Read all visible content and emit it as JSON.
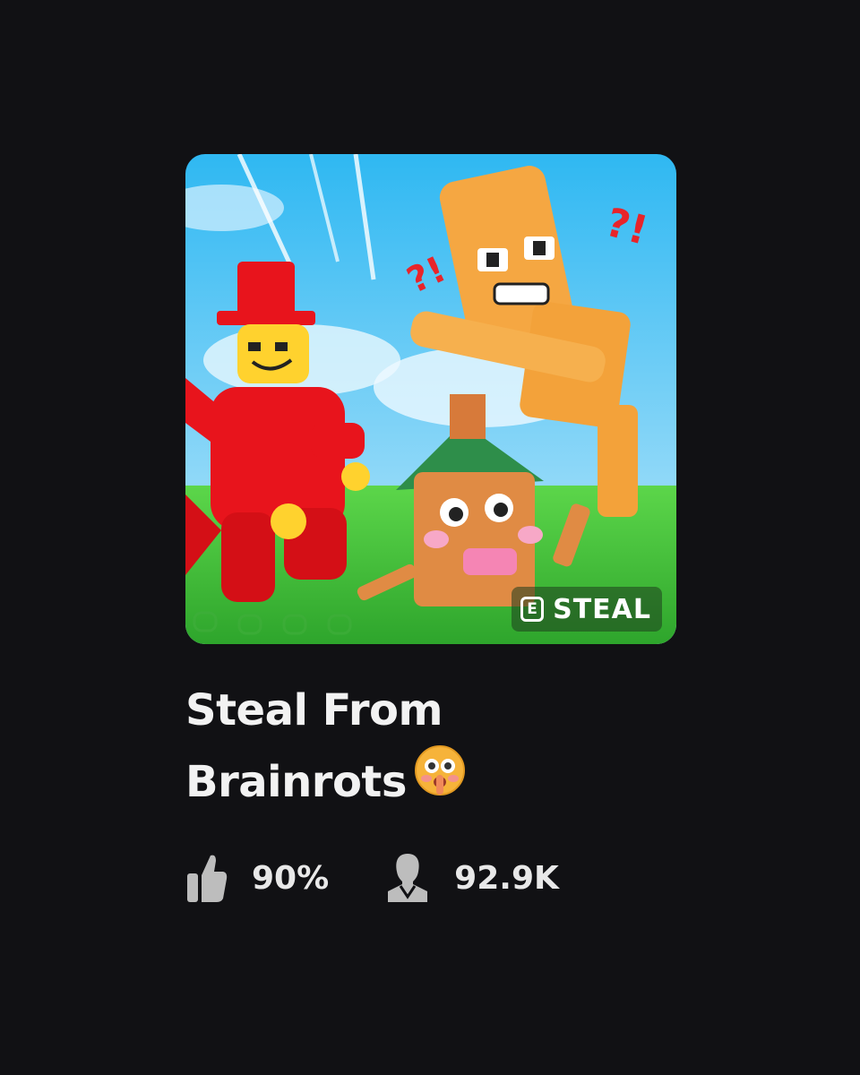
{
  "game": {
    "title_line1": "Steal From",
    "title_line2": "Brainrots",
    "title_emoji": "shushing-face-emoji",
    "thumbnail_badge_key": "E",
    "thumbnail_badge_label": "STEAL",
    "rating": "90%",
    "players": "92.9K"
  },
  "icons": {
    "rating": "thumbs-up-icon",
    "players": "person-icon"
  },
  "colors": {
    "background": "#111114",
    "text": "#f2f2f2",
    "stat_icon": "#bdbdbd"
  }
}
